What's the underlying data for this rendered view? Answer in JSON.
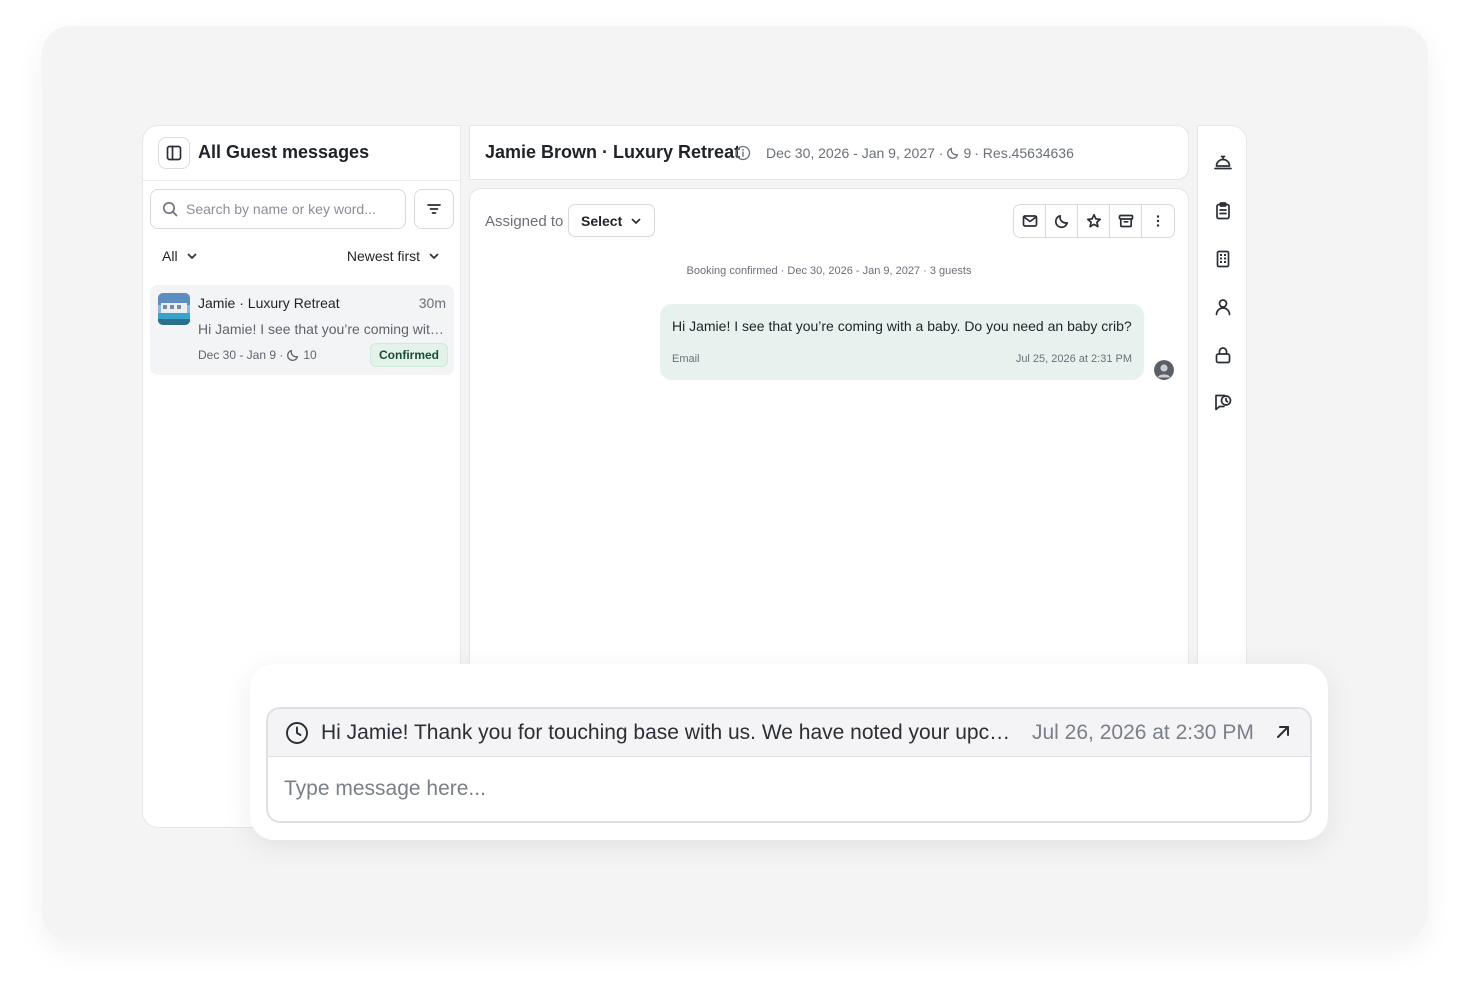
{
  "sidebar": {
    "title": "All Guest messages",
    "search_placeholder": "Search by name or key word...",
    "filter_label": "All",
    "sort_label": "Newest first",
    "conversations": [
      {
        "title": "Jamie · Luxury Retreat",
        "time": "30m",
        "preview": "Hi Jamie! I see that you’re coming with a baby. Do you need an baby crib?",
        "dates": "Dec 30 - Jan 9 ·",
        "nights": "10",
        "status": "Confirmed"
      }
    ]
  },
  "reservation": {
    "title": "Jamie Brown · Luxury Retreat",
    "dates": "Dec 30, 2026 - Jan 9, 2027 ·",
    "nights": "9",
    "reservation_id": "· Res.45634636"
  },
  "thread": {
    "assigned_label": "Assigned to",
    "assign_value": "Select",
    "system_line": "Booking confirmed · Dec 30, 2026 - Jan 9, 2027 · 3 guests",
    "messages": [
      {
        "text": "Hi Jamie! I see that you’re coming with a baby. Do you need an baby crib?",
        "channel": "Email",
        "time": "Jul 25, 2026 at 2:31 PM"
      }
    ]
  },
  "composer": {
    "scheduled_text": "Hi Jamie! Thank you for touching base with us. We have noted your upcoming stay and will prepare everything for your arrival.",
    "scheduled_time": "Jul 26, 2026 at 2:30 PM",
    "placeholder": "Type message here..."
  },
  "icons": {
    "sidebar_toggle": "sidebar-toggle-icon",
    "search": "search-icon",
    "filter": "filter-icon",
    "chevron": "chevron-down-icon",
    "moon": "moon-icon",
    "info": "info-icon",
    "actions": [
      "mail-icon",
      "moon-icon",
      "star-icon",
      "archive-icon",
      "more-vertical-icon"
    ],
    "rail": [
      "concierge-bell-icon",
      "clipboard-icon",
      "building-icon",
      "user-icon",
      "lock-icon",
      "message-clock-icon"
    ],
    "clock": "clock-icon",
    "open": "arrow-up-right-icon"
  },
  "colors": {
    "accent_bubble": "#e7f2ef",
    "badge_bg": "#e3f3ea",
    "badge_text": "#1b4d33"
  }
}
